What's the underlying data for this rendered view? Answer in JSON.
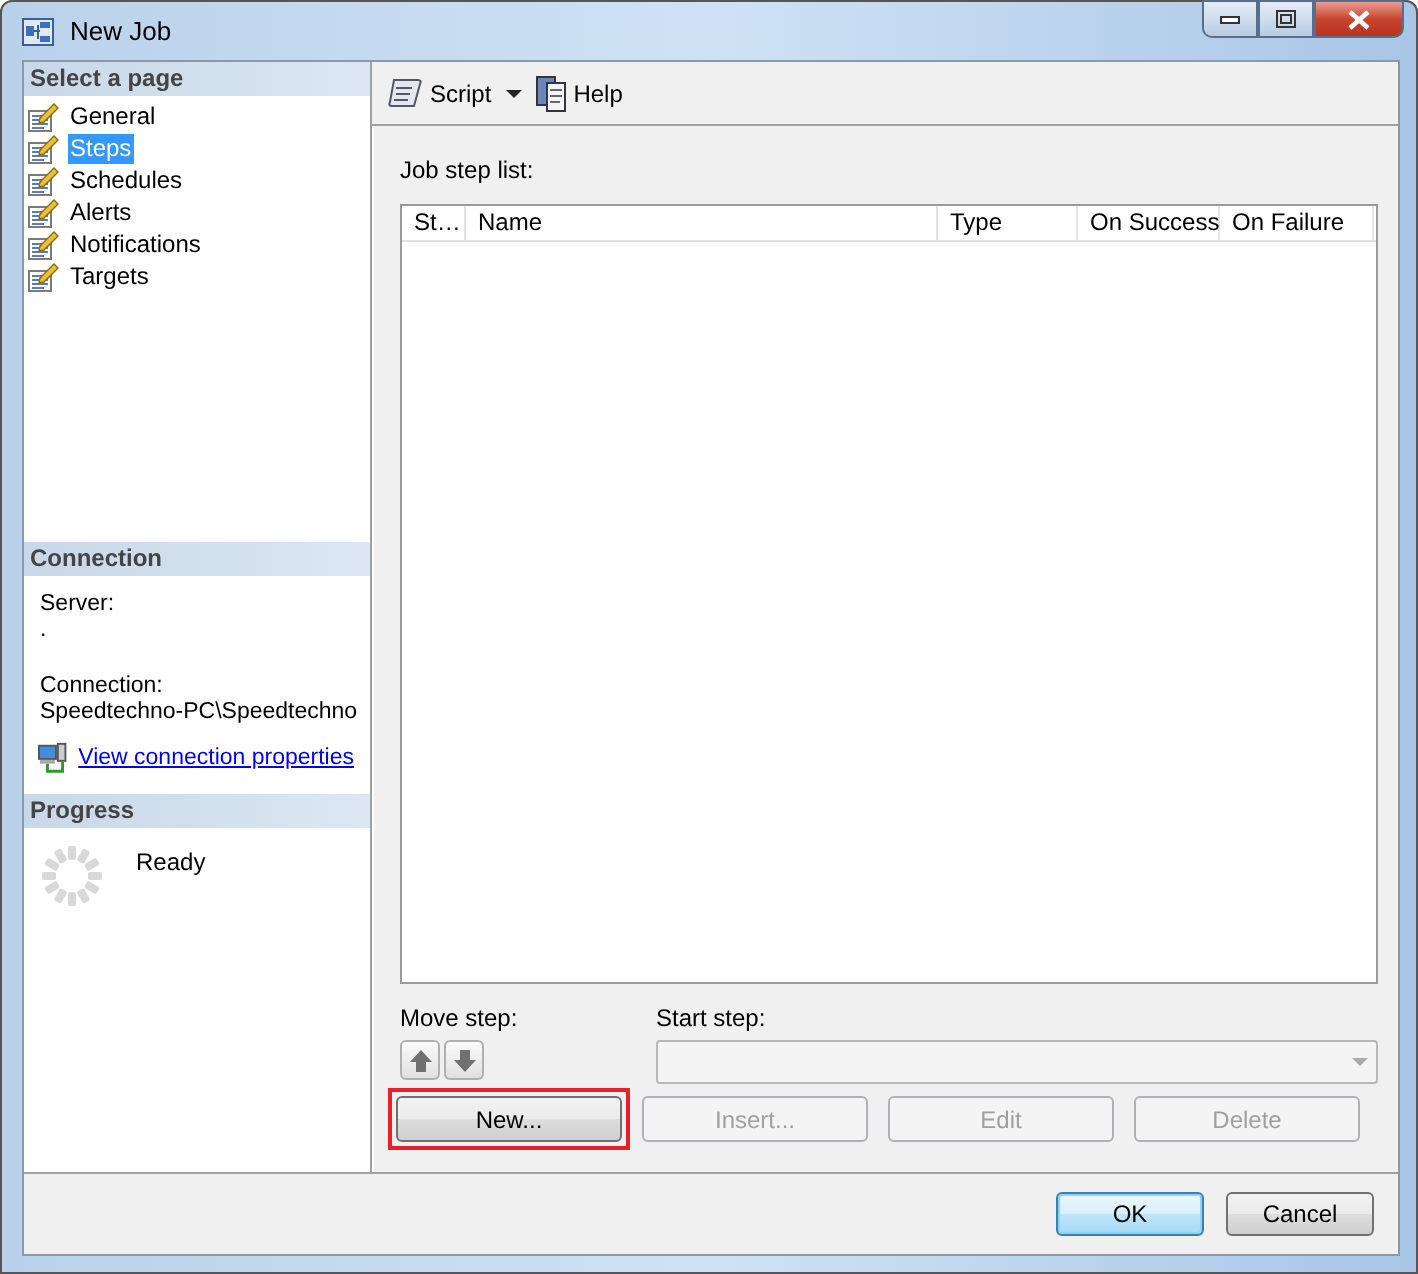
{
  "window": {
    "title": "New Job"
  },
  "sidebar": {
    "header": "Select a page",
    "pages": [
      {
        "label": "General",
        "selected": false
      },
      {
        "label": "Steps",
        "selected": true
      },
      {
        "label": "Schedules",
        "selected": false
      },
      {
        "label": "Alerts",
        "selected": false
      },
      {
        "label": "Notifications",
        "selected": false
      },
      {
        "label": "Targets",
        "selected": false
      }
    ],
    "connection": {
      "header": "Connection",
      "server_label": "Server:",
      "server_value": ".",
      "connection_label": "Connection:",
      "connection_value": "Speedtechno-PC\\Speedtechno",
      "link": "View connection properties"
    },
    "progress": {
      "header": "Progress",
      "status": "Ready"
    }
  },
  "toolbar": {
    "items": [
      {
        "label": "Script",
        "kind": "script"
      },
      {
        "label": "Help",
        "kind": "help"
      }
    ]
  },
  "steps": {
    "label": "Job step list:",
    "columns": [
      "St…",
      "Name",
      "Type",
      "On Success",
      "On Failure"
    ]
  },
  "move_step": {
    "label": "Move step:"
  },
  "start_step": {
    "label": "Start step:",
    "disabled": true
  },
  "actions": [
    {
      "label": "New...",
      "disabled": false,
      "highlighted": true
    },
    {
      "label": "Insert...",
      "disabled": true,
      "highlighted": false
    },
    {
      "label": "Edit",
      "disabled": true,
      "highlighted": false
    },
    {
      "label": "Delete",
      "disabled": true,
      "highlighted": false
    }
  ],
  "buttons": [
    {
      "label": "OK",
      "default": true
    },
    {
      "label": "Cancel",
      "default": false
    }
  ]
}
